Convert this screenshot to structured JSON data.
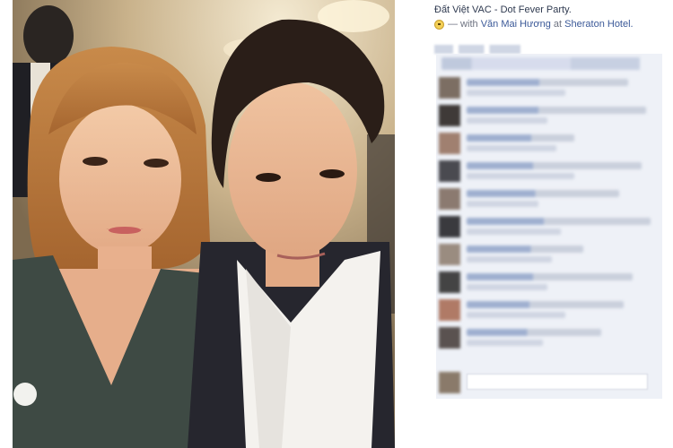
{
  "post": {
    "title": "Đất Việt VAC - Dot Fever Party.",
    "with_prefix": "— with",
    "tagged_person": "Văn Mai Hương",
    "at_word": "at",
    "place": "Sheraton Hotel."
  },
  "icons": {
    "feeling": "smiley-icon"
  },
  "comments": {
    "count_visible": 11
  },
  "colors": {
    "link": "#3b5998",
    "comment_bg": "#eef1f7"
  }
}
